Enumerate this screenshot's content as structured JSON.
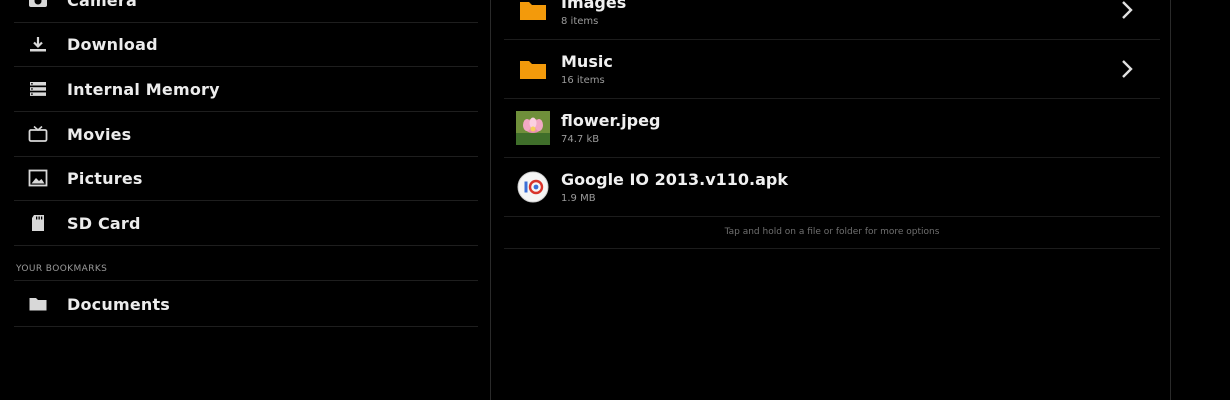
{
  "sidebar": {
    "items": [
      {
        "label": "Camera",
        "icon": "camera-icon"
      },
      {
        "label": "Download",
        "icon": "download-icon"
      },
      {
        "label": "Internal Memory",
        "icon": "internal-memory-icon"
      },
      {
        "label": "Movies",
        "icon": "movies-icon"
      },
      {
        "label": "Pictures",
        "icon": "pictures-icon"
      },
      {
        "label": "SD Card",
        "icon": "sd-card-icon"
      }
    ],
    "bookmarks_header": "YOUR BOOKMARKS",
    "bookmarks": [
      {
        "label": "Documents",
        "icon": "folder-icon"
      }
    ]
  },
  "files": [
    {
      "name": "Images",
      "meta": "8 items",
      "icon": "folder-icon",
      "has_chevron": true
    },
    {
      "name": "Music",
      "meta": "16 items",
      "icon": "folder-icon",
      "has_chevron": true
    },
    {
      "name": "flower.jpeg",
      "meta": "74.7 kB",
      "icon": "image-thumbnail-icon",
      "has_chevron": false
    },
    {
      "name": "Google IO 2013.v110.apk",
      "meta": "1.9 MB",
      "icon": "apk-icon",
      "has_chevron": false
    }
  ],
  "hint": "Tap and hold on a file or folder for more options",
  "colors": {
    "background": "#000000",
    "folder": "#f39a0b",
    "text": "#ececec",
    "subtext": "#9b9b9b"
  }
}
